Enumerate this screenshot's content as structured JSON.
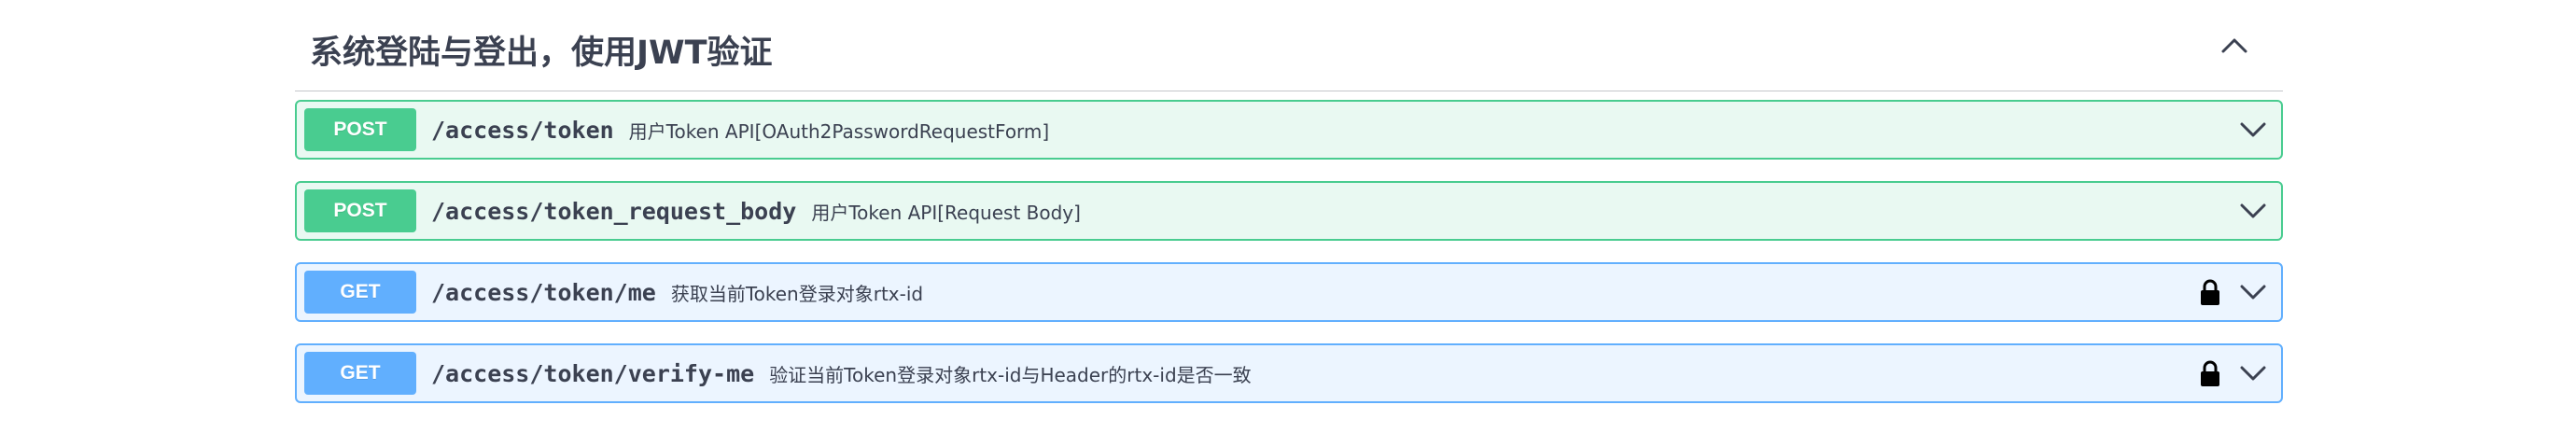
{
  "section": {
    "title": "系统登陆与登出，使用JWT验证",
    "collapse_icon": "chevron-up-icon"
  },
  "operations": [
    {
      "method": "POST",
      "path": "/access/token",
      "summary": "用户Token API[OAuth2PasswordRequestForm]",
      "locked": false,
      "color": "#49cc90"
    },
    {
      "method": "POST",
      "path": "/access/token_request_body",
      "summary": "用户Token API[Request Body]",
      "locked": false,
      "color": "#49cc90"
    },
    {
      "method": "GET",
      "path": "/access/token/me",
      "summary": "获取当前Token登录对象rtx-id",
      "locked": true,
      "color": "#61affe"
    },
    {
      "method": "GET",
      "path": "/access/token/verify-me",
      "summary": "验证当前Token登录对象rtx-id与Header的rtx-id是否一致",
      "locked": true,
      "color": "#61affe"
    }
  ],
  "icons": {
    "expand": "chevron-down-icon",
    "lock": "lock-icon"
  }
}
